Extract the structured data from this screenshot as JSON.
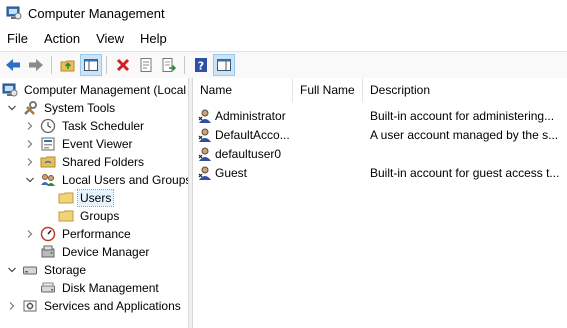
{
  "window": {
    "title": "Computer Management"
  },
  "menu": [
    "File",
    "Action",
    "View",
    "Help"
  ],
  "tree": [
    {
      "label": "Computer Management (Local"
    },
    {
      "label": "System Tools"
    },
    {
      "label": "Task Scheduler"
    },
    {
      "label": "Event Viewer"
    },
    {
      "label": "Shared Folders"
    },
    {
      "label": "Local Users and Groups"
    },
    {
      "label": "Users"
    },
    {
      "label": "Groups"
    },
    {
      "label": "Performance"
    },
    {
      "label": "Device Manager"
    },
    {
      "label": "Storage"
    },
    {
      "label": "Disk Management"
    },
    {
      "label": "Services and Applications"
    }
  ],
  "list": {
    "columns": [
      "Name",
      "Full Name",
      "Description"
    ],
    "rows": [
      {
        "name": "Administrator",
        "full_name": "",
        "description": "Built-in account for administering..."
      },
      {
        "name": "DefaultAcco...",
        "full_name": "",
        "description": "A user account managed by the s..."
      },
      {
        "name": "defaultuser0",
        "full_name": "",
        "description": ""
      },
      {
        "name": "Guest",
        "full_name": "",
        "description": "Built-in account for guest access t..."
      }
    ]
  }
}
